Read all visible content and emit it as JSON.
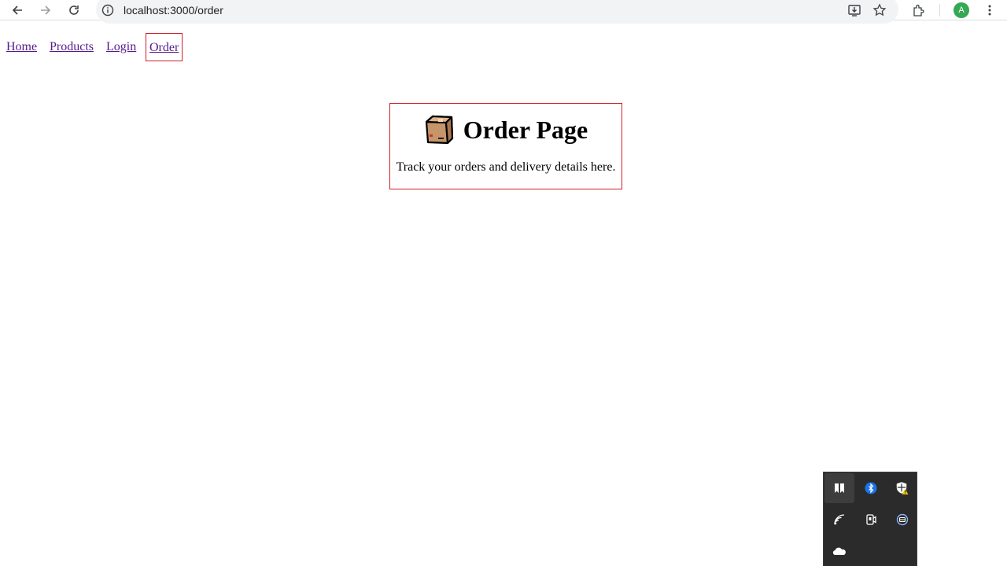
{
  "browser": {
    "url": "localhost:3000/order",
    "profile_initial": "A",
    "buttons": [
      "back",
      "forward",
      "reload",
      "site-info",
      "install",
      "bookmark",
      "extensions",
      "menu"
    ]
  },
  "nav": {
    "items": [
      {
        "label": "Home"
      },
      {
        "label": "Products"
      },
      {
        "label": "Login"
      },
      {
        "label": "Order",
        "active": true
      }
    ]
  },
  "card": {
    "icon": "package-icon",
    "title": "Order Page",
    "text": "Track your orders and delivery details here."
  },
  "tray": {
    "icons": [
      "snip-icon",
      "bluetooth-icon",
      "security-warning-icon",
      "wifi-icon",
      "camera-icon",
      "vpn-icon",
      "onedrive-icon"
    ]
  },
  "colors": {
    "link": "#551a8b",
    "active_border": "#d0202a",
    "avatar": "#34a853",
    "tray_bg": "#2b2b2b"
  }
}
